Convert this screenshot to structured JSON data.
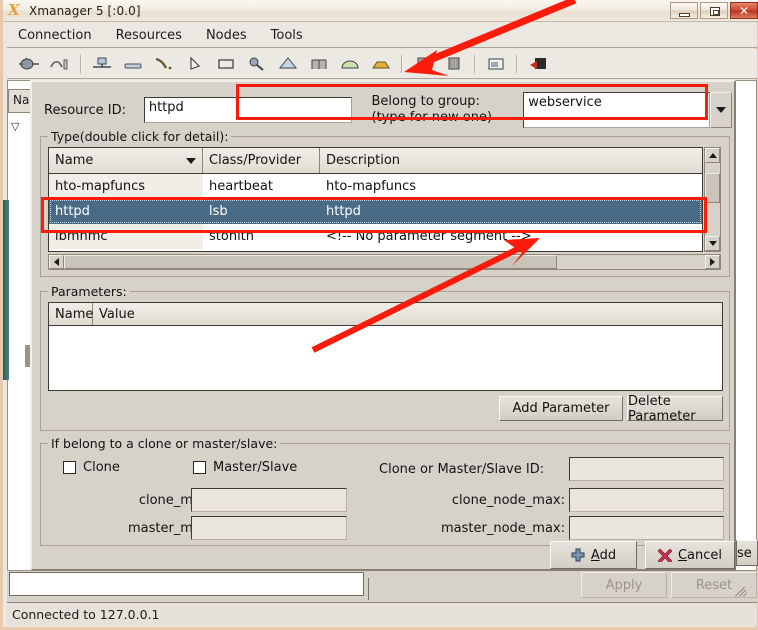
{
  "window": {
    "title": "Xmanager 5 [:0.0]",
    "icon": "xmanager-x-icon",
    "minimize_label": "Minimize",
    "maximize_label": "Maximize",
    "close_label": "Close"
  },
  "menubar": {
    "items": [
      {
        "label": "Connection"
      },
      {
        "label": "Resources"
      },
      {
        "label": "Nodes"
      },
      {
        "label": "Tools"
      }
    ]
  },
  "toolbar": {
    "buttons": [
      {
        "name": "connect-icon",
        "glyph": "≈"
      },
      {
        "name": "disconnect-icon",
        "glyph": "⤴"
      },
      {
        "name": "add-node-icon",
        "glyph": "⊥"
      },
      {
        "name": "standby-node-icon",
        "glyph": "▁"
      },
      {
        "name": "link-icon",
        "glyph": "✒"
      },
      {
        "name": "pointer-icon",
        "glyph": "◤"
      },
      {
        "name": "resource-icon",
        "glyph": "▭"
      },
      {
        "name": "search-icon",
        "glyph": "⚲"
      },
      {
        "name": "group-icon",
        "glyph": "△"
      },
      {
        "name": "clone-icon",
        "glyph": "⊓"
      },
      {
        "name": "master-slave-icon",
        "glyph": "◔"
      },
      {
        "name": "constraint-a-icon",
        "glyph": "▓"
      },
      {
        "name": "constraint-b-icon",
        "glyph": "▓"
      },
      {
        "name": "report-icon",
        "glyph": "▤"
      },
      {
        "name": "shutdown-icon",
        "glyph": "◧"
      }
    ]
  },
  "background_window": {
    "tree_column_header": "Na",
    "apply_label": "Apply",
    "reset_label": "Reset",
    "close_fragment_label": "se"
  },
  "statusbar": {
    "text": "Connected to 127.0.0.1"
  },
  "dialog": {
    "resource_id": {
      "label": "Resource ID:",
      "value": "httpd"
    },
    "group": {
      "label_line1": "Belong to group:",
      "label_line2": "(type for new one)",
      "value": "webservice",
      "dropdown_icon": "chevron-down-icon"
    },
    "type_group": {
      "title": "Type(double click for detail):",
      "columns": [
        "Name",
        "Class/Provider",
        "Description"
      ],
      "sort_indicator": "sort-descending-icon",
      "rows": [
        {
          "name": "hto-mapfuncs",
          "class": "heartbeat",
          "description": "hto-mapfuncs",
          "selected": false
        },
        {
          "name": "httpd",
          "class": "lsb",
          "description": "httpd",
          "selected": true
        },
        {
          "name": "ibmhmc",
          "class": "stonith",
          "description": "<!-- No parameter segment -->",
          "selected": false
        }
      ]
    },
    "parameters_group": {
      "title": "Parameters:",
      "columns": [
        "Name",
        "Value"
      ],
      "rows": [],
      "add_label": "Add Parameter",
      "delete_label": "Delete Parameter"
    },
    "clone_group": {
      "title": "If belong to a clone or master/slave:",
      "clone_label": "Clone",
      "clone_checked": false,
      "master_slave_label": "Master/Slave",
      "master_slave_checked": false,
      "id_label": "Clone or Master/Slave ID:",
      "id_value": "",
      "clone_max_label": "clone_max:",
      "clone_max_value": "",
      "master_max_label": "master_max:",
      "master_max_value": "",
      "clone_node_max_label": "clone_node_max:",
      "clone_node_max_value": "",
      "master_node_max_label": "master_node_max:",
      "master_node_max_value": ""
    },
    "actions": {
      "add_label": "Add",
      "add_icon": "plus-icon",
      "cancel_label": "Cancel",
      "cancel_icon": "x-mark-icon"
    }
  },
  "annotations": {
    "color": "#fb1c0b",
    "highlight_boxes": [
      "resource-id-and-group-row",
      "selected-httpd-row"
    ],
    "arrows": [
      "arrow-to-toolbar",
      "arrow-to-selected-row"
    ]
  }
}
